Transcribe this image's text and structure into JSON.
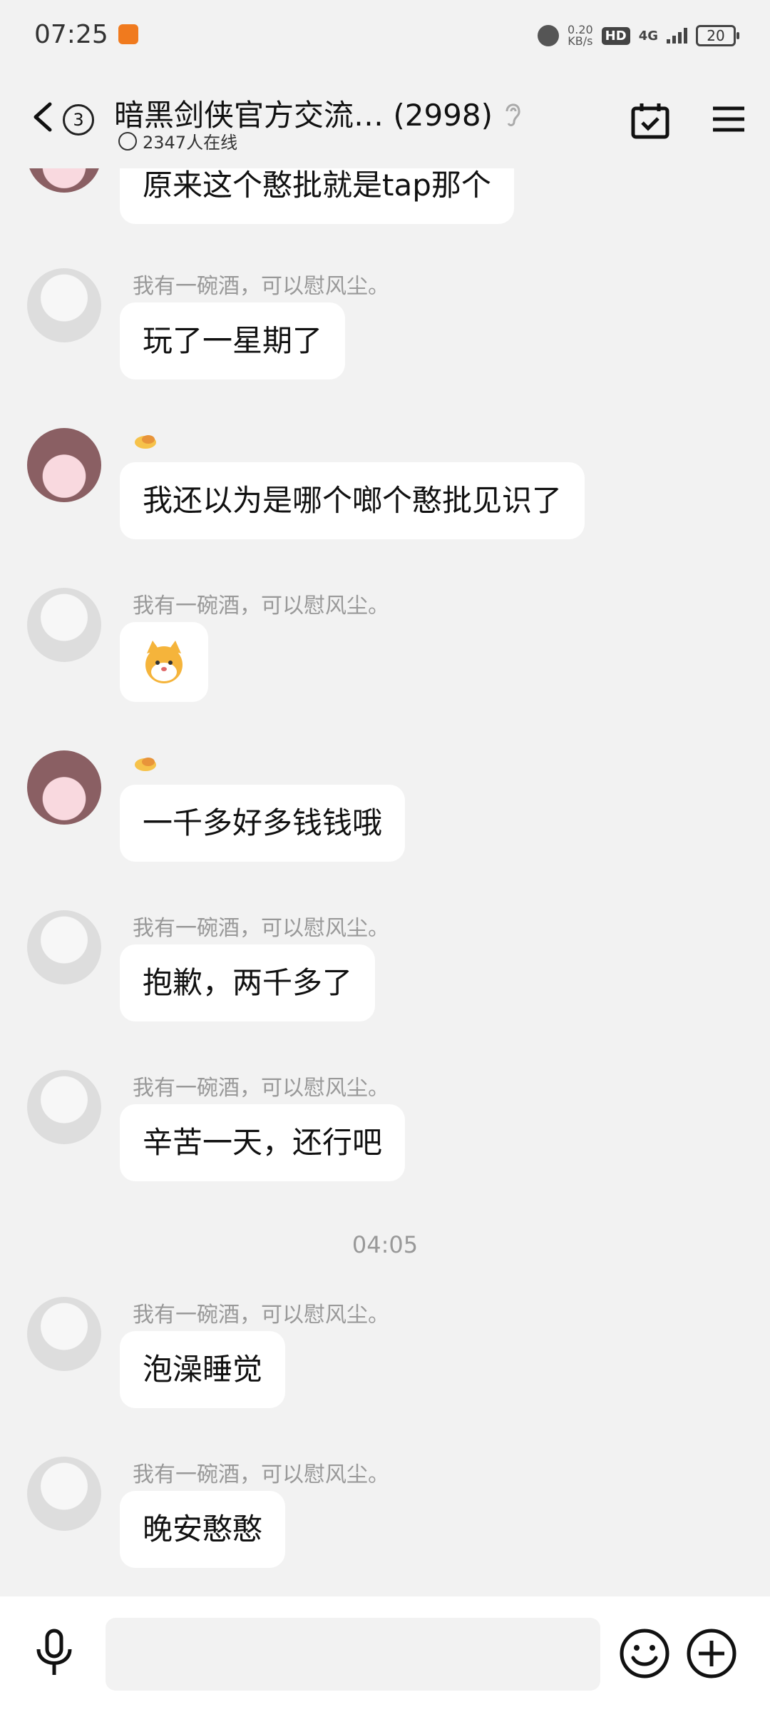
{
  "status_bar": {
    "time": "07:25",
    "speed_value": "0.20",
    "speed_unit": "KB/s",
    "hd": "HD",
    "network": "4G",
    "battery": "20"
  },
  "header": {
    "unread_count": "3",
    "title": "暗黑剑侠官方交流… (2998)",
    "online": "2347人在线"
  },
  "messages": [
    {
      "type": "text",
      "sender": "",
      "text": "原来这个憨批就是tap那个"
    },
    {
      "type": "text",
      "sender": "我有一碗酒，可以慰风尘。",
      "text": "玩了一星期了"
    },
    {
      "type": "text",
      "sender": "",
      "text": "我还以为是哪个啷个憨批见识了"
    },
    {
      "type": "sticker",
      "sender": "我有一碗酒，可以慰风尘。",
      "text": ""
    },
    {
      "type": "text",
      "sender": "",
      "text": "一千多好多钱钱哦"
    },
    {
      "type": "text",
      "sender": "我有一碗酒，可以慰风尘。",
      "text": "抱歉，两千多了"
    },
    {
      "type": "text",
      "sender": "我有一碗酒，可以慰风尘。",
      "text": "辛苦一天，还行吧"
    },
    {
      "type": "text",
      "sender": "我有一碗酒，可以慰风尘。",
      "text": "泡澡睡觉"
    },
    {
      "type": "text",
      "sender": "我有一碗酒，可以慰风尘。",
      "text": "晚安憨憨"
    }
  ],
  "timestamp": "04:05",
  "input": {
    "placeholder": ""
  },
  "icons": [
    "back-icon",
    "ear-icon",
    "calendar-check-icon",
    "menu-icon",
    "mic-icon",
    "emoji-icon",
    "plus-icon"
  ]
}
